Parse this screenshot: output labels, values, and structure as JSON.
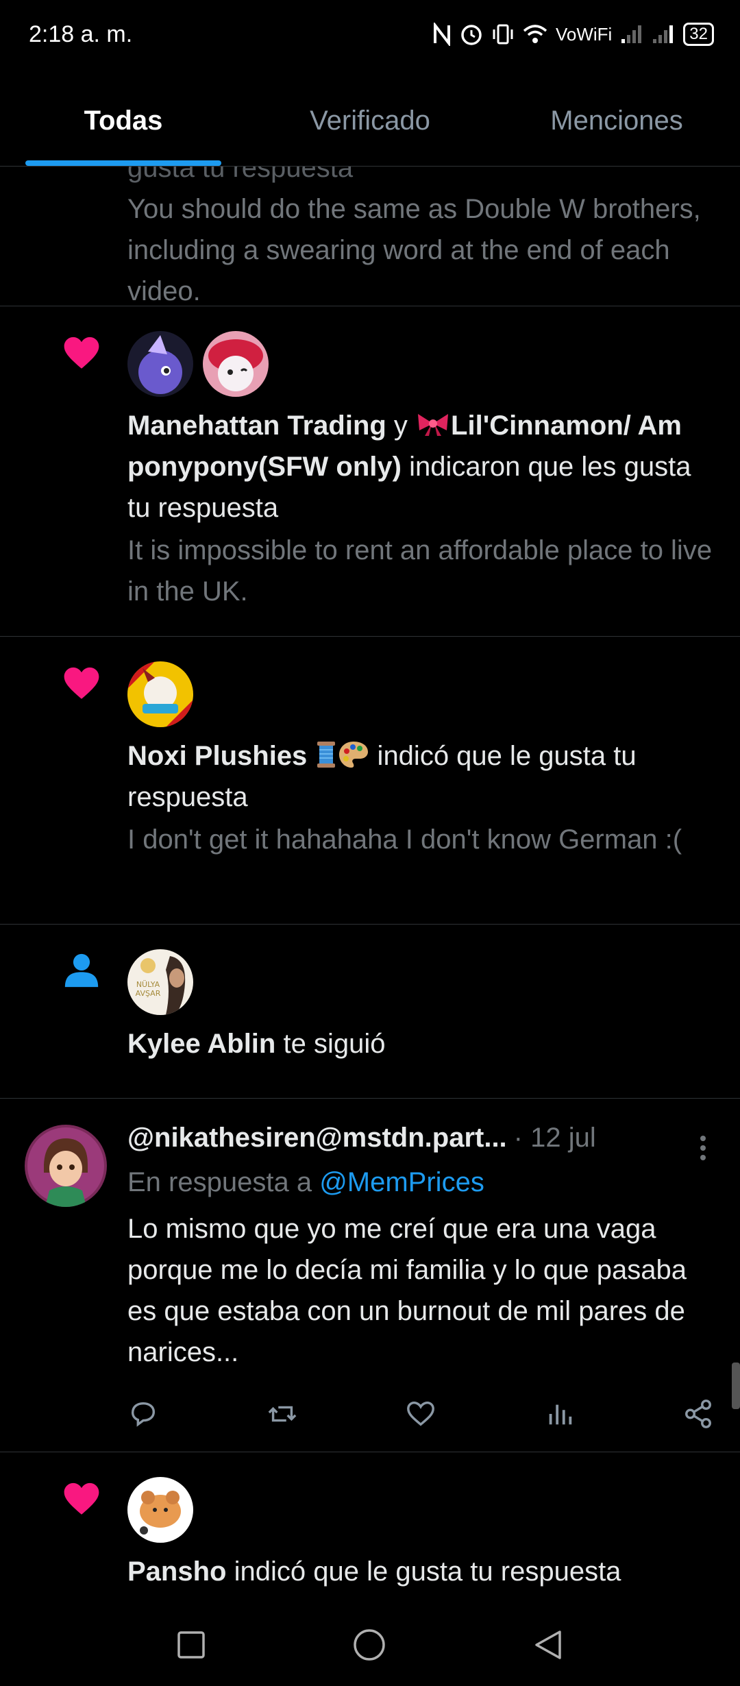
{
  "status": {
    "time": "2:18 a. m.",
    "network_label": "VoWiFi",
    "battery": "32"
  },
  "tabs": [
    {
      "label": "Todas"
    },
    {
      "label": "Verificado"
    },
    {
      "label": "Menciones"
    }
  ],
  "items": {
    "partial": {
      "cut_text": "gusta tu respuesta",
      "quote": "You should do the same as Double W brothers, including a swearing word at the end of each video."
    },
    "like1": {
      "name1": "Manehattan Trading",
      "connector": " y ",
      "name2": "Lil'Cinnamon/ Am ponypony(SFW only)",
      "action": " indicaron que les gusta tu respuesta",
      "quote": "It is impossible to rent an affordable place to live in the UK."
    },
    "like2": {
      "name": "Noxi Plushies",
      "action": " indicó que le gusta tu respuesta",
      "quote": "I don't get it hahahaha I don't know German :("
    },
    "follow": {
      "name": "Kylee Ablin",
      "action": " te siguió",
      "avatar_text_top": "NÜLYA",
      "avatar_text_bottom": "AVŞAR"
    },
    "tweet": {
      "handle": "@nikathesiren@mstdn.part...",
      "date": "· 12 jul",
      "reply_prefix": "En respuesta a ",
      "reply_to": "@MemPrices",
      "text": "Lo mismo que yo me creí que era una vaga porque me lo decía mi familia y lo que pasaba es que estaba con un burnout de mil pares de narices..."
    },
    "like3": {
      "name": "Pansho",
      "action": " indicó que le gusta tu respuesta"
    }
  },
  "colors": {
    "accent": "#1d9bf0",
    "like": "#f91880",
    "muted": "#71767b",
    "divider": "#2f3336"
  }
}
